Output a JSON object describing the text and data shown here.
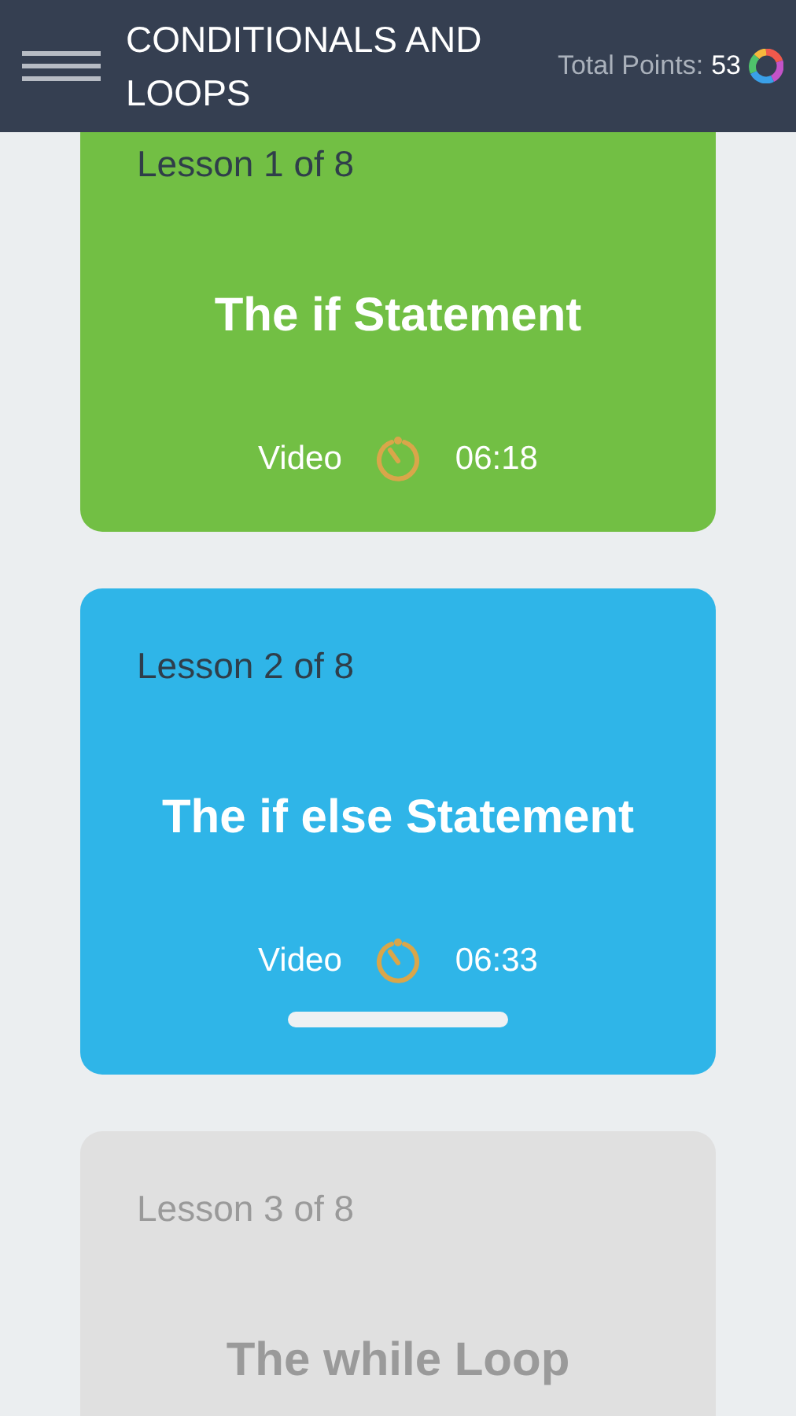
{
  "header": {
    "title": "CONDITIONALS AND LOOPS",
    "points_label": "Total Points:",
    "points_value": "53"
  },
  "lessons": [
    {
      "number": "Lesson 1 of 8",
      "title": "The if Statement",
      "kind": "completed",
      "selected": false,
      "media": "Video",
      "duration": "06:18"
    },
    {
      "number": "Lesson 2 of 8",
      "title": "The if else Statement",
      "kind": "current",
      "selected": true,
      "media": "Video",
      "duration": "06:33"
    },
    {
      "number": "Lesson 3 of 8",
      "title": "The while Loop",
      "kind": "locked",
      "selected": false
    }
  ]
}
